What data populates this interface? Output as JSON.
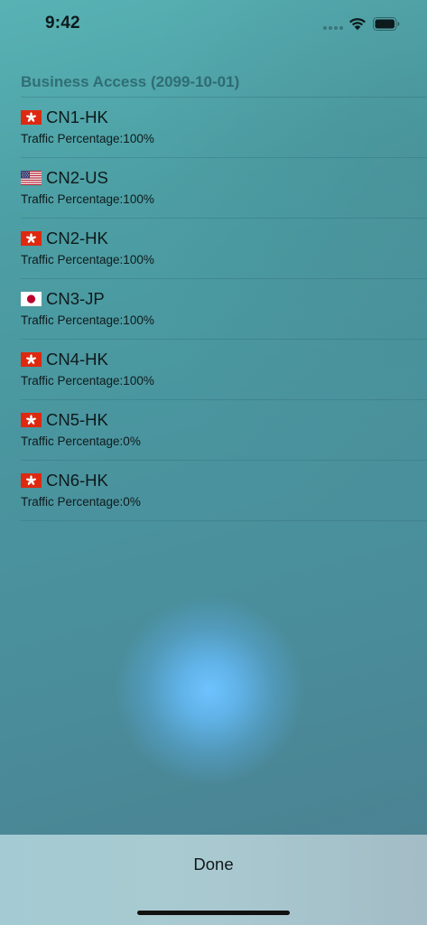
{
  "status_bar": {
    "time": "9:42"
  },
  "section": {
    "title": "Business Access (2099-10-01)"
  },
  "servers": [
    {
      "flag": "hk-flag",
      "name": "CN1-HK",
      "traffic": "Traffic Percentage:100%"
    },
    {
      "flag": "us-flag",
      "name": "CN2-US",
      "traffic": "Traffic Percentage:100%"
    },
    {
      "flag": "hk-flag",
      "name": "CN2-HK",
      "traffic": "Traffic Percentage:100%"
    },
    {
      "flag": "jp-flag",
      "name": "CN3-JP",
      "traffic": "Traffic Percentage:100%"
    },
    {
      "flag": "hk-flag",
      "name": "CN4-HK",
      "traffic": "Traffic Percentage:100%"
    },
    {
      "flag": "hk-flag",
      "name": "CN5-HK",
      "traffic": "Traffic Percentage:0%"
    },
    {
      "flag": "hk-flag",
      "name": "CN6-HK",
      "traffic": "Traffic Percentage:0%"
    }
  ],
  "footer": {
    "done_label": "Done"
  },
  "colors": {
    "hk_red": "#de2910",
    "jp_red": "#bc002d",
    "us_blue": "#3c3b6e",
    "us_red": "#b22234"
  }
}
